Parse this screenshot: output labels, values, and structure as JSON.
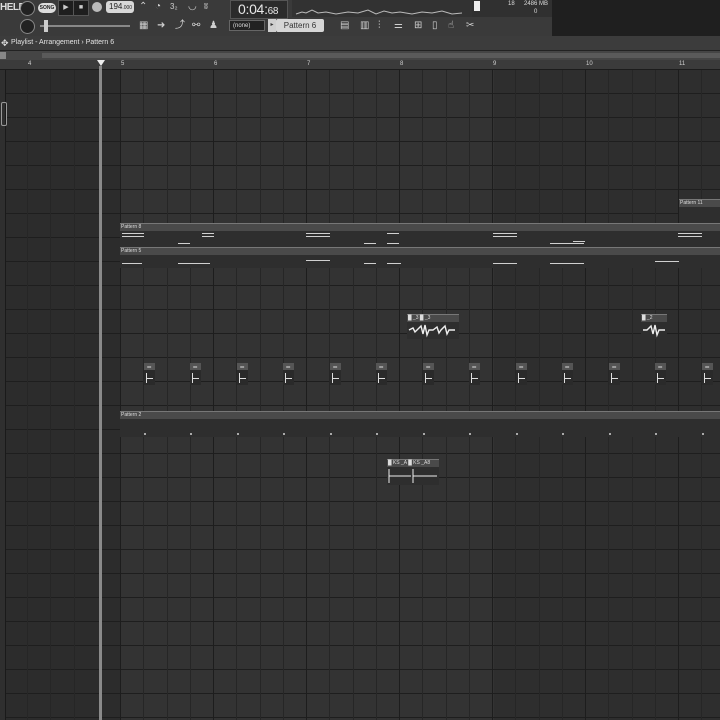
{
  "toolbar": {
    "help_label": "HELP",
    "song_mode": "SONG",
    "tempo_value": "194",
    "tempo_fraction": ".000",
    "time_main": "0:04",
    "time_sub": "68",
    "pattern_selector": "Pattern 6",
    "none_selector": "(none)",
    "cpu_value": "18",
    "memory_value": "2486 MB",
    "poly_value": "0",
    "icon_labels": [
      "step-icon",
      "typing-keyboard-icon",
      "arrow-right-icon",
      "metronome-icon",
      "wait-icon",
      "countdown-icon",
      "blend-icon",
      "loop-record-icon",
      "link-icon",
      "tuner-icon"
    ],
    "right_icons": [
      "playlist-icon",
      "piano-roll-icon",
      "channel-rack-icon",
      "mixer-icon",
      "plugin-picker-icon",
      "browser-icon",
      "file-icon",
      "touch-icon",
      "cut-icon"
    ]
  },
  "titlebar": {
    "title": "Playlist - Arrangement › Pattern 6"
  },
  "ruler": {
    "bars": [
      "4",
      "5",
      "6",
      "7",
      "8",
      "9",
      "10",
      "11"
    ]
  },
  "clips": {
    "pattern8": "Pattern 8",
    "pattern5": "Pattern 5",
    "pattern2": "Pattern 2",
    "pattern11": "Pattern 11",
    "audio_a": "█ _3 █ _3",
    "audio_b": "█ _2",
    "audio_c": "█ KS _A █ KS _A8"
  }
}
